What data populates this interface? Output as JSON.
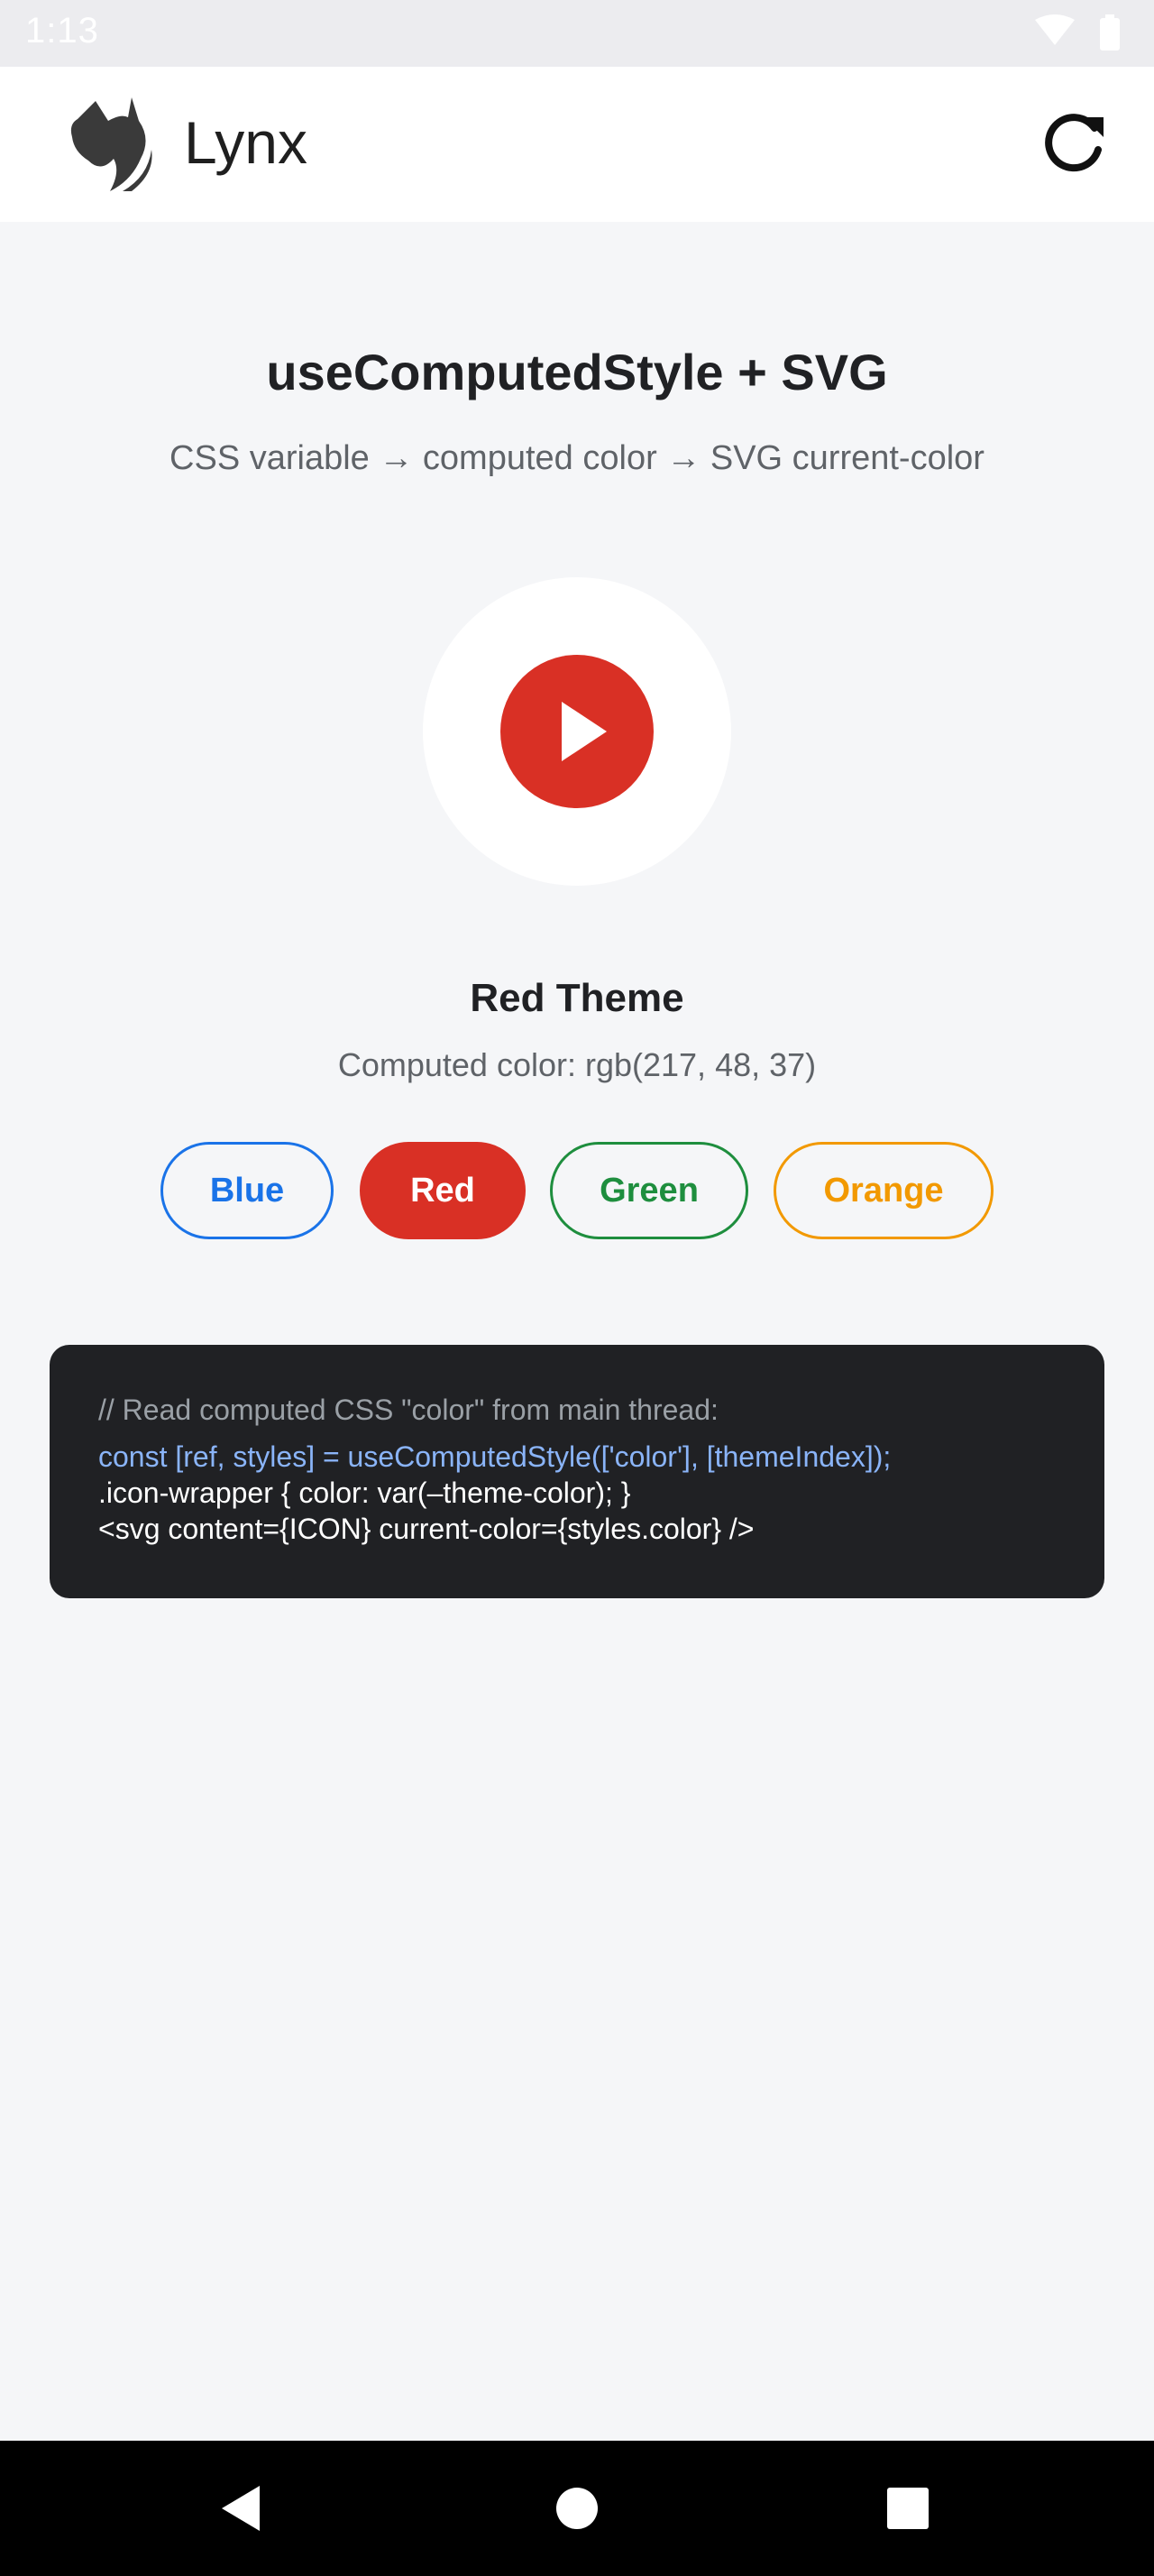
{
  "status_bar": {
    "time": "1:13"
  },
  "app_bar": {
    "title": "Lynx",
    "logo_icon": "lynx-logo",
    "reload_icon": "reload-icon"
  },
  "main": {
    "title": "useComputedStyle + SVG",
    "subtitle": "CSS variable → computed color → SVG current-color",
    "icon": "play-icon",
    "theme_name": "Red Theme",
    "computed_color": "Computed color: rgb(217, 48, 37)",
    "accent_color": "#d93025"
  },
  "theme_buttons": [
    {
      "label": "Blue",
      "color": "#1a73e8",
      "selected": false
    },
    {
      "label": "Red",
      "color": "#d93025",
      "selected": true
    },
    {
      "label": "Green",
      "color": "#1e8e3e",
      "selected": false
    },
    {
      "label": "Orange",
      "color": "#f29900",
      "selected": false
    }
  ],
  "code_block": {
    "comment": "// Read computed CSS \"color\" from main thread:",
    "highlight": "const [ref, styles] = useComputedStyle(['color'], [themeIndex]);",
    "line2": ".icon-wrapper { color: var(–theme-color); }",
    "line3": "<svg content={ICON} current-color={styles.color} />"
  },
  "nav_bar": {
    "icons": [
      "back-icon",
      "home-icon",
      "recents-icon"
    ]
  }
}
